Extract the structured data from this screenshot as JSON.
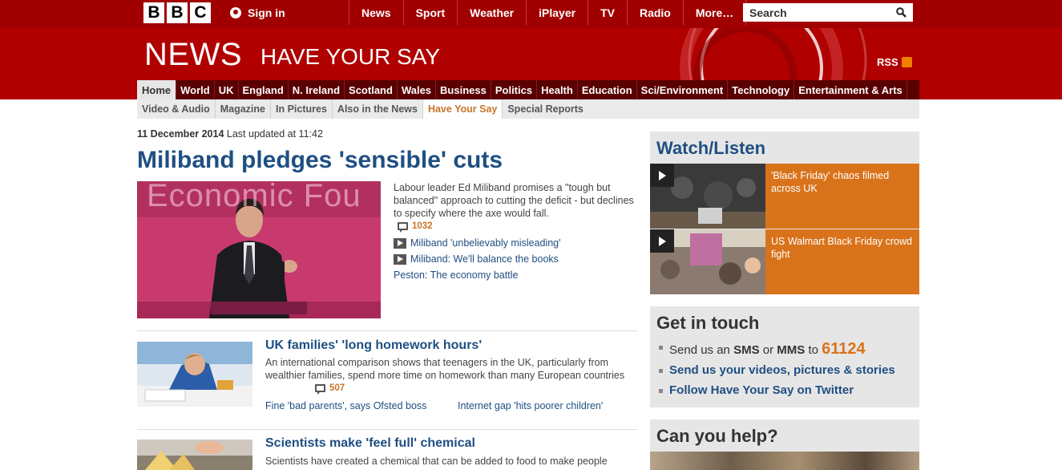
{
  "topbar": {
    "logo": [
      "B",
      "B",
      "C"
    ],
    "signin_label": "Sign in",
    "nav": [
      "News",
      "Sport",
      "Weather",
      "iPlayer",
      "TV",
      "Radio",
      "More…"
    ],
    "search_placeholder": "Search"
  },
  "banner": {
    "title": "NEWS",
    "subtitle": "HAVE YOUR SAY",
    "rss_label": "RSS"
  },
  "main_nav": [
    "Home",
    "World",
    "UK",
    "England",
    "N. Ireland",
    "Scotland",
    "Wales",
    "Business",
    "Politics",
    "Health",
    "Education",
    "Sci/Environment",
    "Technology",
    "Entertainment & Arts"
  ],
  "sub_nav": [
    "Video & Audio",
    "Magazine",
    "In Pictures",
    "Also in the News",
    "Have Your Say",
    "Special Reports"
  ],
  "top_story": {
    "date": "11 December 2014",
    "updated": "Last updated at 11:42",
    "headline": "Miliband pledges 'sensible' cuts",
    "image_text": "Economic Fou",
    "summary": "Labour leader Ed Miliband promises a \"tough but balanced\" approach to cutting the deficit - but declines to specify where the axe would fall.",
    "comments": "1032",
    "links": [
      "Miliband 'unbelievably misleading'",
      "Miliband: We'll balance the books",
      "Peston: The economy battle"
    ]
  },
  "stories": [
    {
      "title": "UK families' 'long homework hours'",
      "summary": "An international comparison shows that teenagers in the UK, particularly from wealthier families, spend more time on homework than many European countries",
      "comments": "507",
      "links": [
        "Fine 'bad parents', says Ofsted boss",
        "Internet gap 'hits poorer children'"
      ]
    },
    {
      "title": "Scientists make 'feel full' chemical",
      "summary": "Scientists have created a chemical that can be added to food to make people"
    }
  ],
  "watch_listen": {
    "title": "Watch/Listen",
    "items": [
      "'Black Friday' chaos filmed across UK",
      "US Walmart Black Friday crowd fight"
    ]
  },
  "get_in_touch": {
    "title": "Get in touch",
    "sms_prefix": "Send us an",
    "sms": "SMS",
    "or": "or",
    "mms": "MMS",
    "to": "to",
    "number": "61124",
    "videos": "Send us your videos, pictures & stories",
    "twitter": "Follow Have Your Say on Twitter"
  },
  "can_you_help": {
    "title": "Can you help?"
  },
  "colors": {
    "brand_red": "#a10000",
    "link_blue": "#1f4f82",
    "accent_orange": "#d9731b"
  }
}
